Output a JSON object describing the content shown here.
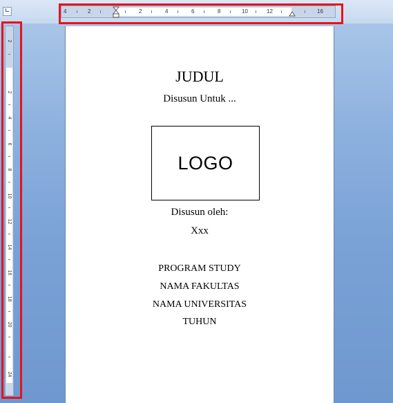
{
  "ruler": {
    "corner_icon": "tab-left-icon",
    "horizontal_labels": [
      "4",
      "2",
      "2",
      "4",
      "6",
      "8",
      "10",
      "12",
      "16"
    ],
    "vertical_labels": [
      "2",
      "2",
      "4",
      "6",
      "8",
      "10",
      "12",
      "14",
      "16",
      "18",
      "20",
      "24"
    ]
  },
  "document": {
    "title": "JUDUL",
    "subtitle": "Disusun Untuk ...",
    "logo_text": "LOGO",
    "prepared_by_label": "Disusun oleh:",
    "author": "Xxx",
    "lines": [
      "PROGRAM STUDY",
      "NAMA FAKULTAS",
      "NAMA UNIVERSITAS",
      "TUHUN"
    ]
  },
  "colors": {
    "highlight": "#e8121a",
    "background": "#7aa2d6",
    "ruler": "#c8d6e8"
  }
}
